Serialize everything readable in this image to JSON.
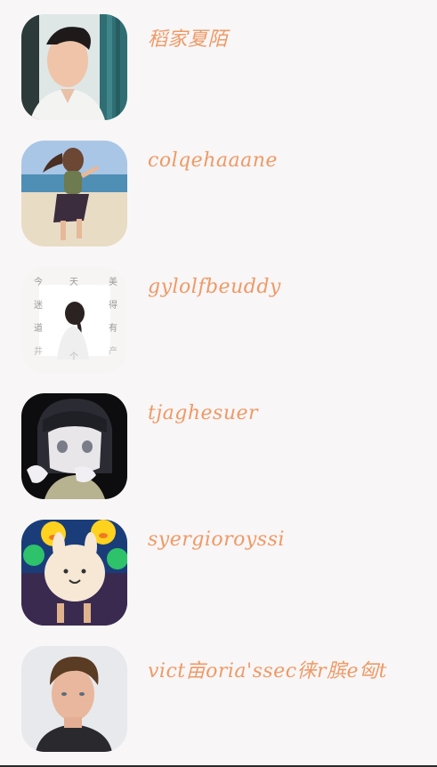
{
  "contacts": [
    {
      "name": "稻家夏陌",
      "avatar": "avatar-young-man-curtain"
    },
    {
      "name": "colqehaaane",
      "avatar": "avatar-girl-beach"
    },
    {
      "name": "gylolfbeuddy",
      "avatar": "avatar-girl-text-poster"
    },
    {
      "name": "tjaghesuer",
      "avatar": "avatar-anime-girl"
    },
    {
      "name": "syergioroyssi",
      "avatar": "avatar-bear-balloon"
    },
    {
      "name": "vict亩oria'ssec徕r膑e匈t",
      "avatar": "avatar-young-man"
    }
  ],
  "avatar_text": [
    "今",
    "天",
    "美",
    "迷",
    "得",
    "道",
    "有",
    "井",
    "个",
    "产"
  ],
  "colors": {
    "name_text": "#ee9a66",
    "background": "#f8f6f7"
  }
}
